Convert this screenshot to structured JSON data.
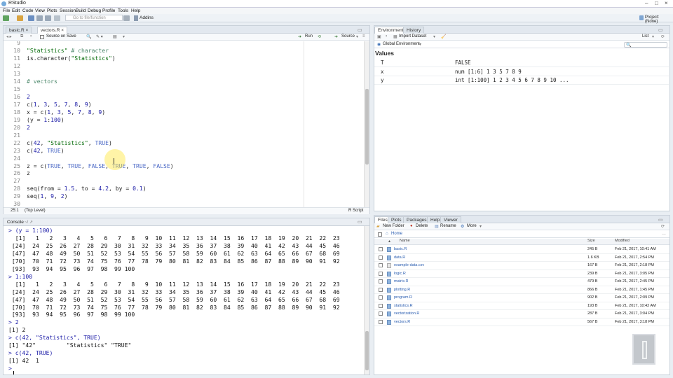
{
  "window": {
    "title": "RStudio"
  },
  "menu": [
    "File",
    "Edit",
    "Code",
    "View",
    "Plots",
    "Session",
    "Build",
    "Debug",
    "Profile",
    "Tools",
    "Help"
  ],
  "toolbar": {
    "goto_placeholder": "Go to file/function",
    "addins": "Addins",
    "project": "Project: (None)"
  },
  "editor": {
    "tabs": [
      "basic.R",
      "vectors.R"
    ],
    "source_on_save": "Source on Save",
    "run": "Run",
    "source": "Source",
    "status_pos": "25:1",
    "status_scope": "(Top Level)",
    "status_type": "R Script",
    "lines": [
      {
        "n": "9",
        "t": ""
      },
      {
        "n": "10",
        "t": "\"Statistics\" # character"
      },
      {
        "n": "11",
        "t": "is.character(\"Statistics\")"
      },
      {
        "n": "12",
        "t": ""
      },
      {
        "n": "13",
        "t": ""
      },
      {
        "n": "14",
        "t": "# vectors"
      },
      {
        "n": "15",
        "t": ""
      },
      {
        "n": "16",
        "t": "2"
      },
      {
        "n": "17",
        "t": "c(1, 3, 5, 7, 8, 9)"
      },
      {
        "n": "18",
        "t": "x = c(1, 3, 5, 7, 8, 9)"
      },
      {
        "n": "19",
        "t": "(y = 1:100)"
      },
      {
        "n": "20",
        "t": "2"
      },
      {
        "n": "21",
        "t": ""
      },
      {
        "n": "22",
        "t": "c(42, \"Statistics\", TRUE)"
      },
      {
        "n": "23",
        "t": "c(42, TRUE)"
      },
      {
        "n": "24",
        "t": ""
      },
      {
        "n": "25",
        "t": "z = c(TRUE, TRUE, FALSE, TRUE, TRUE, FALSE)"
      },
      {
        "n": "26",
        "t": "z"
      },
      {
        "n": "27",
        "t": ""
      },
      {
        "n": "28",
        "t": "seq(from = 1.5, to = 4.2, by = 0.1)"
      },
      {
        "n": "29",
        "t": "seq(1, 9, 2)"
      },
      {
        "n": "30",
        "t": ""
      }
    ]
  },
  "console": {
    "title": "Console",
    "lines": [
      {
        "k": "cmd",
        "t": "> (y = 1:100)"
      },
      {
        "k": "out",
        "t": "  [1]   1   2   3   4   5   6   7   8   9  10  11  12  13  14  15  16  17  18  19  20  21  22  23"
      },
      {
        "k": "out",
        "t": " [24]  24  25  26  27  28  29  30  31  32  33  34  35  36  37  38  39  40  41  42  43  44  45  46"
      },
      {
        "k": "out",
        "t": " [47]  47  48  49  50  51  52  53  54  55  56  57  58  59  60  61  62  63  64  65  66  67  68  69"
      },
      {
        "k": "out",
        "t": " [70]  70  71  72  73  74  75  76  77  78  79  80  81  82  83  84  85  86  87  88  89  90  91  92"
      },
      {
        "k": "out",
        "t": " [93]  93  94  95  96  97  98  99 100"
      },
      {
        "k": "cmd",
        "t": "> 1:100"
      },
      {
        "k": "out",
        "t": "  [1]   1   2   3   4   5   6   7   8   9  10  11  12  13  14  15  16  17  18  19  20  21  22  23"
      },
      {
        "k": "out",
        "t": " [24]  24  25  26  27  28  29  30  31  32  33  34  35  36  37  38  39  40  41  42  43  44  45  46"
      },
      {
        "k": "out",
        "t": " [47]  47  48  49  50  51  52  53  54  55  56  57  58  59  60  61  62  63  64  65  66  67  68  69"
      },
      {
        "k": "out",
        "t": " [70]  70  71  72  73  74  75  76  77  78  79  80  81  82  83  84  85  86  87  88  89  90  91  92"
      },
      {
        "k": "out",
        "t": " [93]  93  94  95  96  97  98  99 100"
      },
      {
        "k": "cmd",
        "t": "> 2"
      },
      {
        "k": "out",
        "t": "[1] 2"
      },
      {
        "k": "cmd",
        "t": "> c(42, \"Statistics\", TRUE)"
      },
      {
        "k": "out",
        "t": "[1] \"42\"         \"Statistics\" \"TRUE\""
      },
      {
        "k": "cmd",
        "t": "> c(42, TRUE)"
      },
      {
        "k": "out",
        "t": "[1] 42  1"
      },
      {
        "k": "cmd",
        "t": "> "
      }
    ]
  },
  "environment": {
    "tabs": [
      "Environment",
      "History"
    ],
    "import": "Import Dataset",
    "global": "Global Environment",
    "list": "List",
    "values_header": "Values",
    "rows": [
      {
        "name": "T",
        "value": "FALSE"
      },
      {
        "name": "x",
        "value": "num [1:6] 1 3 5 7 8 9"
      },
      {
        "name": "y",
        "value": "int [1:100] 1 2 3 4 5 6 7 8 9 10 ..."
      }
    ]
  },
  "files": {
    "tabs": [
      "Files",
      "Plots",
      "Packages",
      "Help",
      "Viewer"
    ],
    "actions": [
      "New Folder",
      "Delete",
      "Rename",
      "More"
    ],
    "breadcrumb": "Home",
    "columns": [
      "Name",
      "Size",
      "Modified"
    ],
    "rows": [
      {
        "name": "basic.R",
        "size": "245 B",
        "mod": "Feb 21, 2017, 10:41 AM",
        "kind": "r"
      },
      {
        "name": "data.R",
        "size": "1.6 KB",
        "mod": "Feb 21, 2017, 2:54 PM",
        "kind": "r"
      },
      {
        "name": "example-data.csv",
        "size": "167 B",
        "mod": "Feb 21, 2017, 2:18 PM",
        "kind": "csv"
      },
      {
        "name": "logic.R",
        "size": "239 B",
        "mod": "Feb 21, 2017, 3:05 PM",
        "kind": "r"
      },
      {
        "name": "matrix.R",
        "size": "479 B",
        "mod": "Feb 21, 2017, 2:45 PM",
        "kind": "r"
      },
      {
        "name": "plotting.R",
        "size": "866 B",
        "mod": "Feb 21, 2017, 1:45 PM",
        "kind": "r"
      },
      {
        "name": "program.R",
        "size": "902 B",
        "mod": "Feb 21, 2017, 2:09 PM",
        "kind": "r"
      },
      {
        "name": "statistics.R",
        "size": "193 B",
        "mod": "Feb 21, 2017, 10:42 AM",
        "kind": "r"
      },
      {
        "name": "vectorization.R",
        "size": "287 B",
        "mod": "Feb 21, 2017, 3:04 PM",
        "kind": "r"
      },
      {
        "name": "vectors.R",
        "size": "567 B",
        "mod": "Feb 21, 2017, 3:18 PM",
        "kind": "r"
      }
    ]
  }
}
